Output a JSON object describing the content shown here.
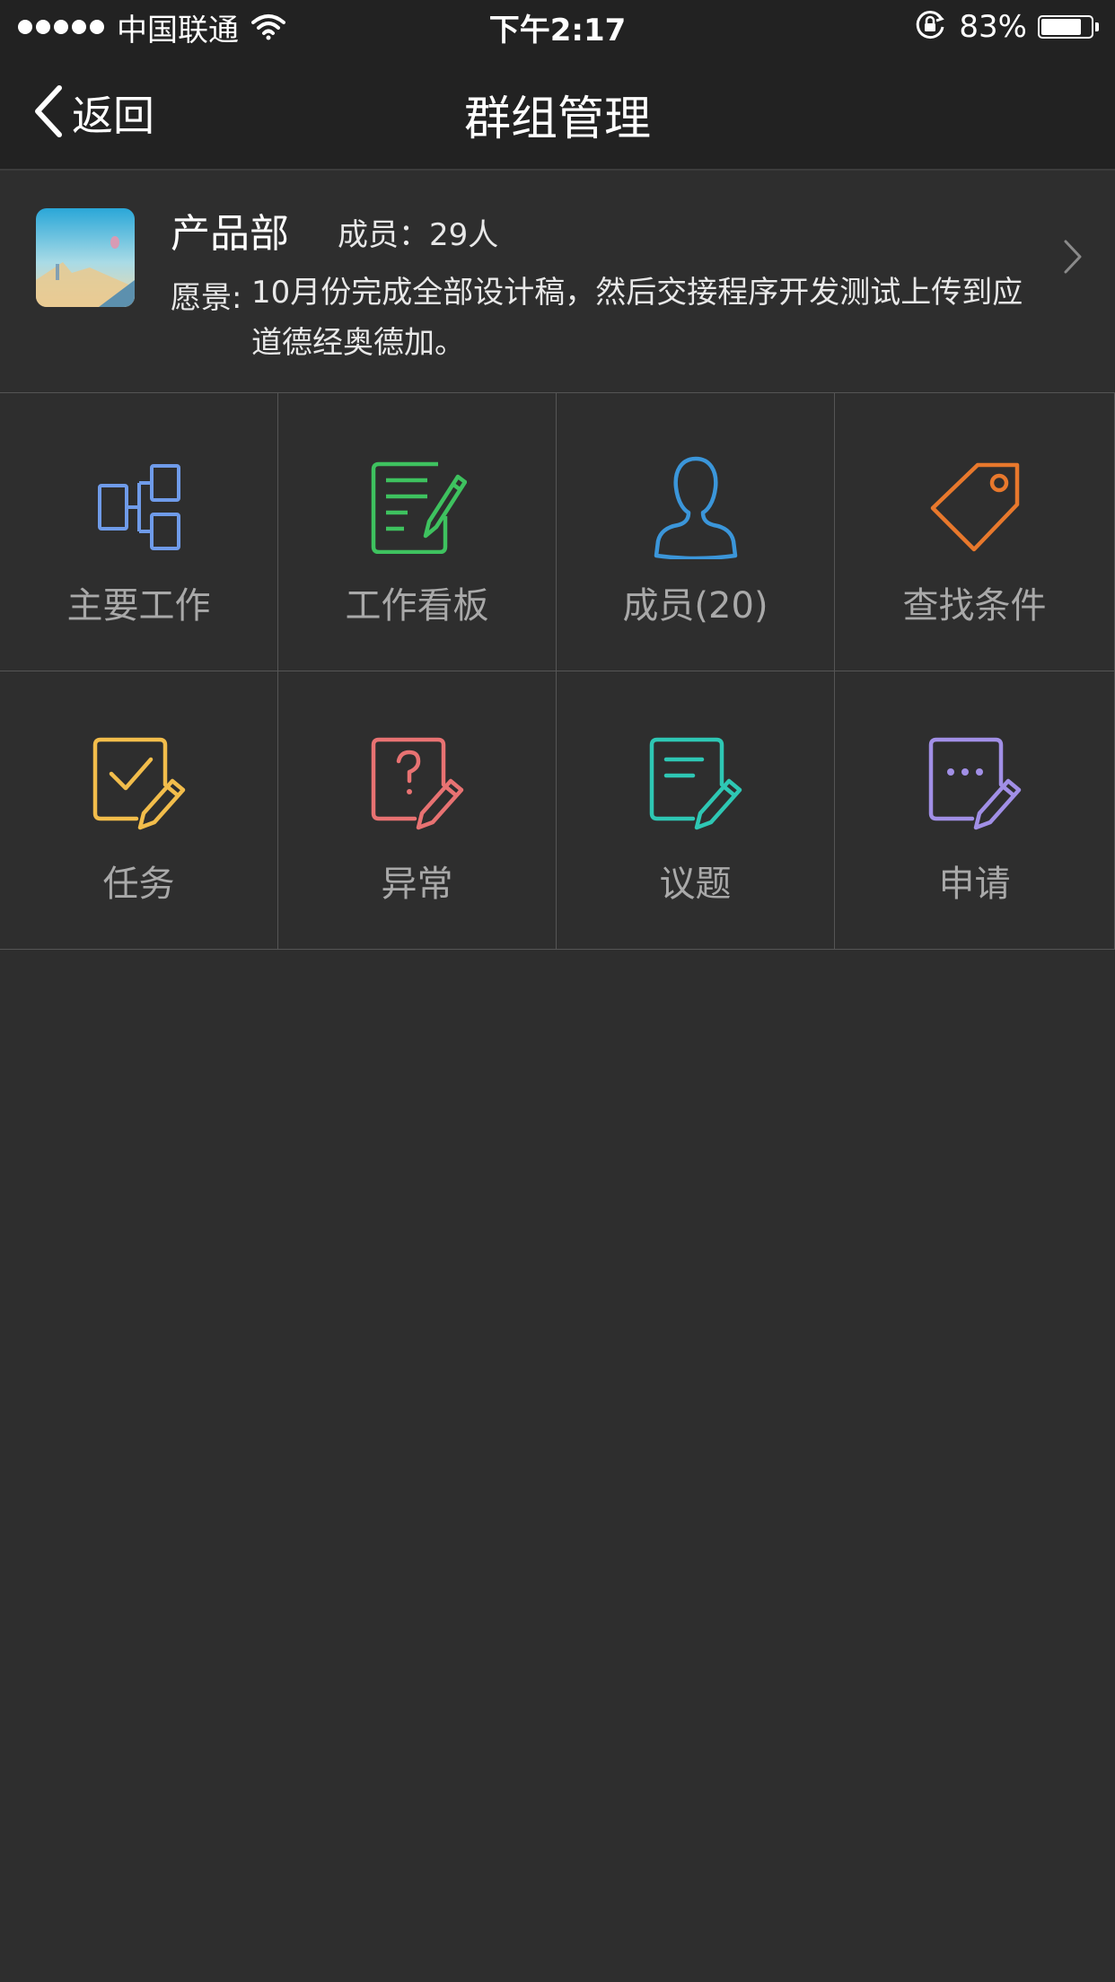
{
  "status_bar": {
    "carrier": "中国联通",
    "time": "下午2:17",
    "battery_percent": "83%",
    "battery_level": 0.83,
    "signal_dots": 5
  },
  "nav": {
    "back_label": "返回",
    "title": "群组管理"
  },
  "group": {
    "name": "产品部",
    "member_count": "成员：29人",
    "vision_label": "愿景:",
    "vision_text": "10月份完成全部设计稿，然后交接程序开发测试上传到应道德经奥德加。"
  },
  "grid": {
    "items": [
      {
        "label": "主要工作",
        "icon": "org-chart-icon",
        "color": "#6f9be9"
      },
      {
        "label": "工作看板",
        "icon": "board-edit-icon",
        "color": "#3ec25f"
      },
      {
        "label": "成员(20)",
        "icon": "person-icon",
        "color": "#3b96da"
      },
      {
        "label": "查找条件",
        "icon": "tag-icon",
        "color": "#e8782c"
      },
      {
        "label": "任务",
        "icon": "task-check-icon",
        "color": "#f2bd4b"
      },
      {
        "label": "异常",
        "icon": "question-doc-icon",
        "color": "#e87272"
      },
      {
        "label": "议题",
        "icon": "topic-doc-icon",
        "color": "#2ec7b4"
      },
      {
        "label": "申请",
        "icon": "apply-doc-icon",
        "color": "#a18fe6"
      }
    ]
  },
  "colors": {
    "background": "#2e2e2e",
    "bar": "#222222",
    "label_gray": "#a9a9a9",
    "divider": "#555555"
  }
}
